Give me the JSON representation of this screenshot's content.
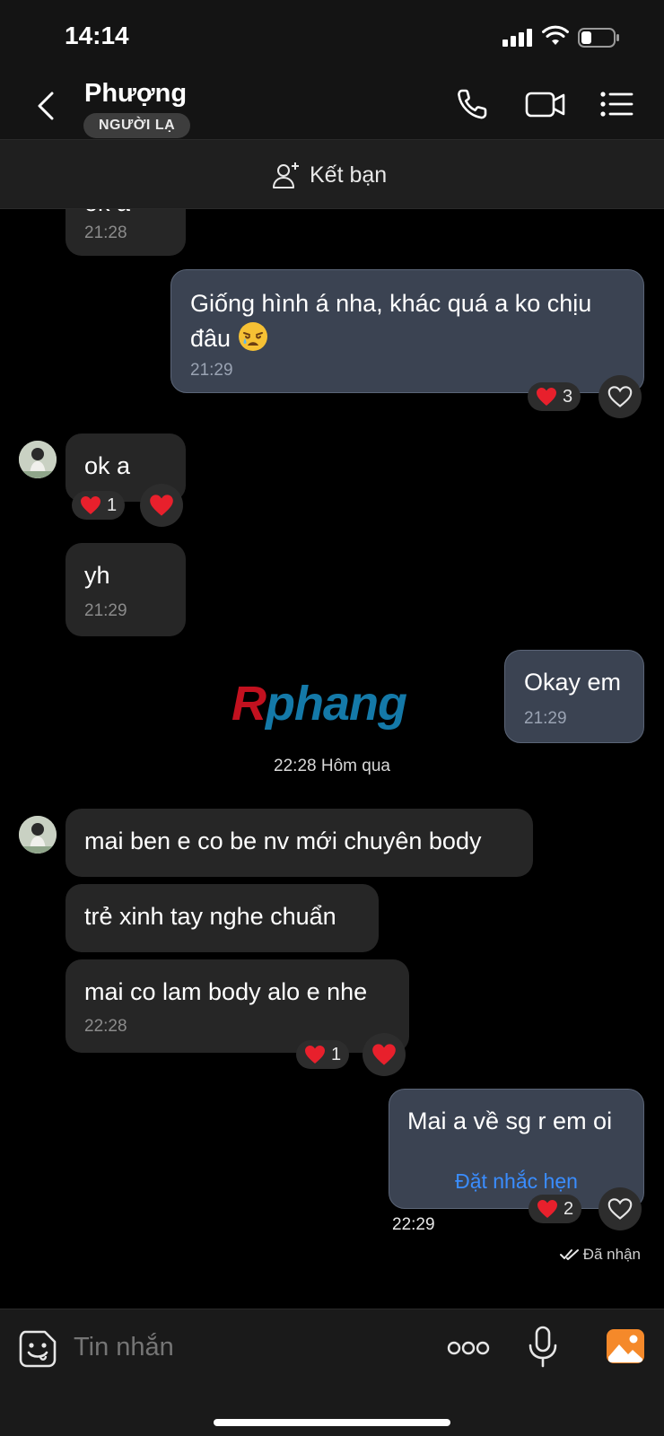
{
  "status_bar": {
    "time": "14:14"
  },
  "header": {
    "contact_name": "Phượng",
    "badge": "NGƯỜI LẠ",
    "icons": [
      "back-chevron-icon",
      "phone-icon",
      "video-camera-icon",
      "menu-list-icon"
    ]
  },
  "add_friend": {
    "label": "Kết bạn",
    "icon": "add-person-icon"
  },
  "messages": [
    {
      "dir": "in",
      "text": "ok a",
      "time": "21:28"
    },
    {
      "dir": "out",
      "text_line1": "Giống hình á nha, khác quá a ko chịu",
      "text_line2": "đâu",
      "emoji": "weary-face",
      "time": "21:29",
      "reaction_count": "3"
    },
    {
      "dir": "in",
      "text": "ok a",
      "reaction_count": "1"
    },
    {
      "dir": "in",
      "text": "yh",
      "time": "21:29"
    },
    {
      "dir": "out",
      "text": "Okay em",
      "time": "21:29"
    },
    {
      "dir": "in",
      "text": "mai ben e co be nv mới chuyên body"
    },
    {
      "dir": "in",
      "text": "trẻ xinh tay nghe chuẩn"
    },
    {
      "dir": "in",
      "text": "mai co lam body alo e nhe",
      "time": "22:28",
      "reaction_count": "1"
    },
    {
      "dir": "out",
      "text": "Mai a về sg r em oi",
      "reminder": "Đặt nhắc hẹn",
      "time": "22:29",
      "reaction_count": "2"
    }
  ],
  "day_separator": "22:28 Hôm qua",
  "watermark": {
    "first": "R",
    "rest": "phang"
  },
  "delivery_status": "Đã nhận",
  "composer": {
    "placeholder": "Tin nhắn"
  },
  "colors": {
    "background": "#000000",
    "incoming_bubble": "#262626",
    "outgoing_bubble": "#3b4352",
    "link_blue": "#3a8dff",
    "heart_red": "#e8202c",
    "gallery_orange": "#f5892a"
  }
}
